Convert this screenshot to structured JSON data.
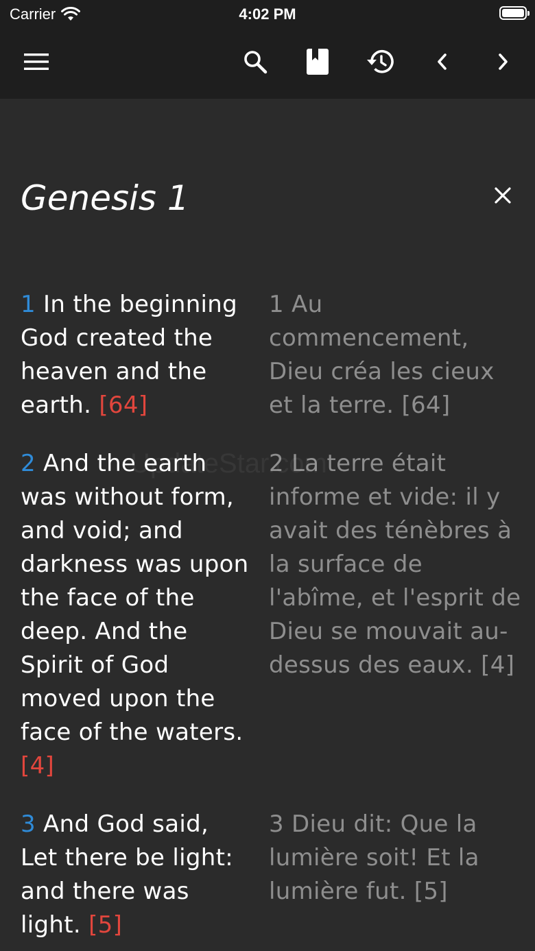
{
  "status_bar": {
    "carrier": "Carrier",
    "time": "4:02 PM"
  },
  "toolbar": {
    "icons": [
      "menu-icon",
      "search-icon",
      "bookmark-icon",
      "history-icon",
      "chevron-left-icon",
      "chevron-right-icon"
    ]
  },
  "chapter": {
    "title": "Genesis 1"
  },
  "verses": [
    {
      "num": "1",
      "en_text": " In the beginning God created the heaven and the earth. ",
      "en_ref": "[64]",
      "fr_text": "1 Au commencement, Dieu créa les cieux et la terre. [64]"
    },
    {
      "num": "2",
      "en_text": " And the earth was without form, and void; and darkness was upon the face of the deep. And the Spirit of God moved upon the face of the waters. ",
      "en_ref": "[4]",
      "fr_text": "2 La terre était informe et vide: il y avait des ténèbres à la surface de l'abîme, et l'esprit de Dieu se mouvait au-dessus des eaux. [4]"
    },
    {
      "num": "3",
      "en_text": " And God said, Let there be light: and there was light. ",
      "en_ref": "[5]",
      "fr_text": "3 Dieu dit: Que la lumière soit! Et la lumière fut. [5]"
    }
  ],
  "watermark": "UpdateStar.com",
  "colors": {
    "background": "#2b2b2b",
    "toolbar": "#1e1e1e",
    "verse_number": "#2f8bd8",
    "reference": "#e2463d",
    "secondary_text": "#8e8e8e"
  }
}
